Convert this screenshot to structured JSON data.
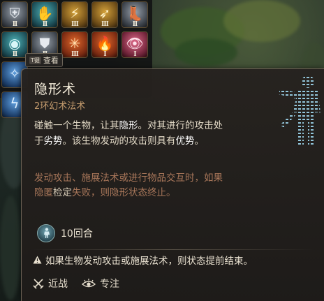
{
  "hotbar": {
    "slots": [
      {
        "row": 0,
        "col": 0,
        "icon": "shield-icon",
        "tier": "II",
        "theme": "grey"
      },
      {
        "row": 0,
        "col": 1,
        "icon": "hand-ward-icon",
        "tier": "II",
        "theme": "teal"
      },
      {
        "row": 0,
        "col": 2,
        "icon": "lightning-bolt-icon",
        "tier": "III",
        "theme": "gold"
      },
      {
        "row": 0,
        "col": 3,
        "icon": "arrow-icon",
        "tier": "III",
        "theme": "gold"
      },
      {
        "row": 0,
        "col": 4,
        "icon": "boots-icon",
        "tier": "II",
        "theme": "grey"
      },
      {
        "row": 1,
        "col": 0,
        "icon": "sphere-icon",
        "tier": "II",
        "theme": "teal"
      },
      {
        "row": 1,
        "col": 1,
        "icon": "shield-wall-icon",
        "tier": "II",
        "theme": "grey"
      },
      {
        "row": 1,
        "col": 2,
        "icon": "web-icon",
        "tier": "III",
        "theme": "red"
      },
      {
        "row": 1,
        "col": 3,
        "icon": "flame-icon",
        "tier": "I",
        "theme": "red"
      },
      {
        "row": 1,
        "col": 4,
        "icon": "eye-icon",
        "tier": "I",
        "theme": "pink"
      },
      {
        "row": 2,
        "col": 0,
        "icon": "feather-icon",
        "tier": "",
        "theme": "blue"
      },
      {
        "row": 3,
        "col": 0,
        "icon": "lightning-icon",
        "tier": "",
        "theme": "blue"
      }
    ]
  },
  "hint": {
    "key": "T键",
    "label": "查看"
  },
  "tooltip": {
    "title": "隐形术",
    "subtitle": "2环幻术法术",
    "desc_a": "碰触一个生物，让其",
    "desc_kw1": "隐形",
    "desc_b": "。对其进行的攻击处于",
    "desc_kw2": "劣势",
    "desc_c": "。该生物发动的攻击则具有",
    "desc_kw3": "优势",
    "desc_d": "。",
    "note_a": "发动攻击、施展法术或进行物品交互时，如果隐匿",
    "note_kw": "检定",
    "note_b": "失败，则隐形状态终止。",
    "duration": "10回合",
    "warning": "如果生物发动攻击或施展法术，则状态提前结束。",
    "footer": {
      "range_label": "近战",
      "concentration_label": "专注"
    }
  },
  "colors": {
    "title": "#f2ead8",
    "subtitle": "#c49b6d",
    "note": "#a9775a",
    "panel": "#26221f",
    "border": "#6e6356"
  }
}
